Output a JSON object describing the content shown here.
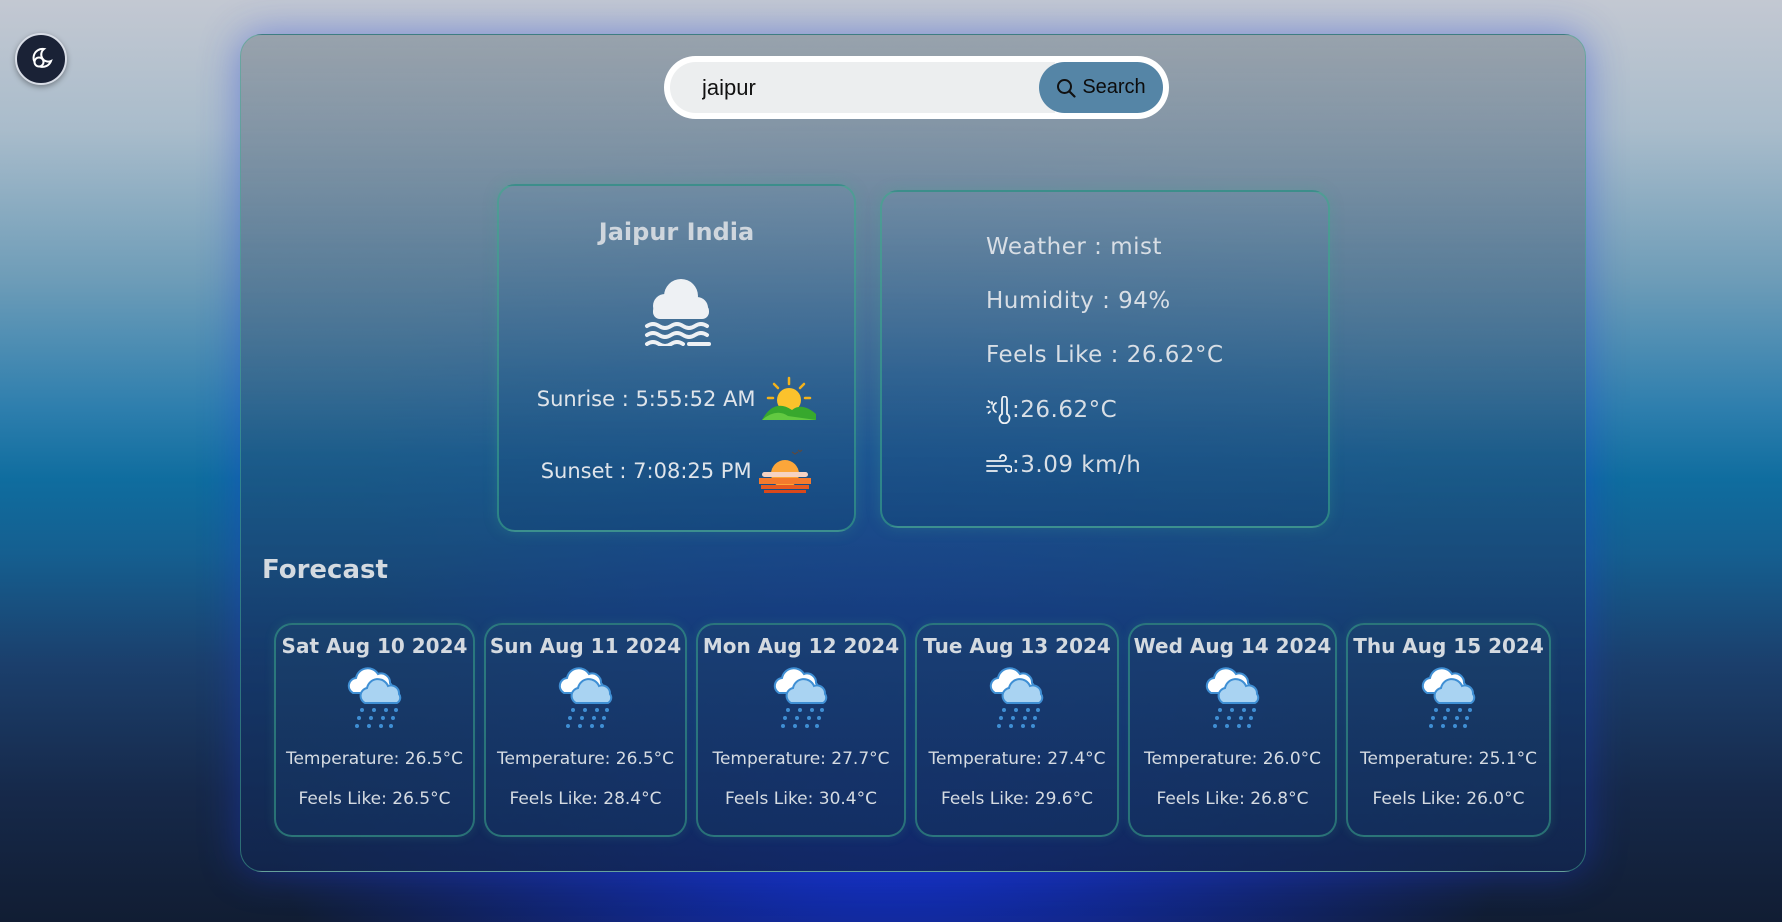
{
  "header": {
    "theme_toggle_icon": "moon-sun-icon"
  },
  "search": {
    "value": "jaipur",
    "placeholder": "",
    "button_label": "Search",
    "button_icon": "search-icon"
  },
  "current": {
    "city": "Jaipur India",
    "icon": "fog-cloud-icon",
    "sunrise": "Sunrise : 5:55:52 AM",
    "sunset": "Sunset : 7:08:25 PM",
    "weather": "Weather : mist",
    "humidity": "Humidity : 94%",
    "feels_like": "Feels Like : 26.62°C",
    "temperature": ":26.62°C",
    "wind": ":3.09 km/h"
  },
  "forecast": {
    "title": "Forecast",
    "days": [
      {
        "date": "Sat Aug 10 2024",
        "temperature": "Temperature: 26.5°C",
        "feels_like": "Feels Like: 26.5°C"
      },
      {
        "date": "Sun Aug 11 2024",
        "temperature": "Temperature: 26.5°C",
        "feels_like": "Feels Like: 28.4°C"
      },
      {
        "date": "Mon Aug 12 2024",
        "temperature": "Temperature: 27.7°C",
        "feels_like": "Feels Like: 30.4°C"
      },
      {
        "date": "Tue Aug 13 2024",
        "temperature": "Temperature: 27.4°C",
        "feels_like": "Feels Like: 29.6°C"
      },
      {
        "date": "Wed Aug 14 2024",
        "temperature": "Temperature: 26.0°C",
        "feels_like": "Feels Like: 26.8°C"
      },
      {
        "date": "Thu Aug 15 2024",
        "temperature": "Temperature: 25.1°C",
        "feels_like": "Feels Like: 26.0°C"
      }
    ]
  },
  "colors": {
    "search_button": "#5585a6",
    "card_border": "#3caa8c",
    "glow": "#1230d2"
  }
}
